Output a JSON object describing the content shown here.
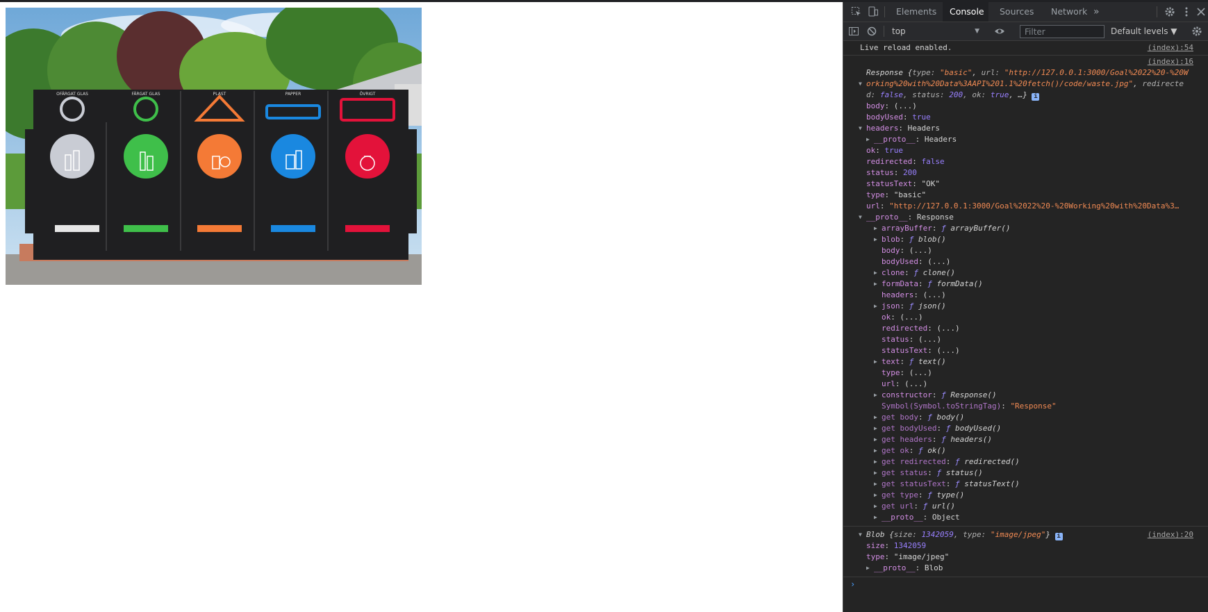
{
  "page": {
    "photo_alt": "Recycling station with bins labeled OFÄRGAT GLAS, FÄRGAT GLAS, PLAST, PAPPER, ÖVRIGT",
    "bin_labels": [
      "OFÄRGAT GLAS",
      "FÄRGAT GLAS",
      "PLAST",
      "PAPPER",
      "ÖVRIGT"
    ],
    "bin_colors": [
      "#c9ccd4",
      "#3fbf4a",
      "#f47a36",
      "#1a88e0",
      "#e3123a"
    ]
  },
  "devtools": {
    "tabs": [
      "Elements",
      "Console",
      "Sources",
      "Network"
    ],
    "active_tab": "Console",
    "more_tabs_glyph": "»",
    "context": "top",
    "filter_placeholder": "Filter",
    "levels": "Default levels ▼",
    "icons": [
      "inspect-icon",
      "device-toggle-icon",
      "settings-gear-icon",
      "kebab-menu-icon",
      "close-icon",
      "sidebar-toggle-icon",
      "clear-console-icon",
      "eye-icon"
    ]
  },
  "console": {
    "live_reload": "Live reload enabled.",
    "live_reload_src": "(index):54",
    "response_src": "(index):16",
    "blob_src": "(index):20",
    "response_summary": {
      "name": "Response",
      "type_val": "\"basic\"",
      "url_val_part1": "\"http://127.0.0.1:3000/Goal%2022%20-%20W",
      "url_val_part2": "orking%20with%20Data%3AAPI%201.1%20fetch()/code/waste.jpg\"",
      "redirected_part": "d",
      "redirected_val": "false",
      "status_val": "200",
      "ok_val": "true"
    },
    "response_props": [
      {
        "key": "body",
        "val": "(...)",
        "kind": "plain"
      },
      {
        "key": "bodyUsed",
        "val": "true",
        "kind": "bool"
      },
      {
        "key": "headers",
        "val": "Headers",
        "kind": "expanded"
      },
      {
        "key": "__proto__",
        "val": "Headers",
        "kind": "nested"
      },
      {
        "key": "ok",
        "val": "true",
        "kind": "bool"
      },
      {
        "key": "redirected",
        "val": "false",
        "kind": "bool"
      },
      {
        "key": "status",
        "val": "200",
        "kind": "num"
      },
      {
        "key": "statusText",
        "val": "\"OK\"",
        "kind": "str"
      },
      {
        "key": "type",
        "val": "\"basic\"",
        "kind": "str"
      },
      {
        "key": "url",
        "val": "\"http://127.0.0.1:3000/Goal%2022%20-%20Working%20with%20Data%3…",
        "kind": "str"
      },
      {
        "key": "__proto__",
        "val": "Response",
        "kind": "expanded"
      }
    ],
    "proto_members": [
      {
        "key": "arrayBuffer",
        "fn": "arrayBuffer()",
        "expandable": true
      },
      {
        "key": "blob",
        "fn": "blob()",
        "expandable": true
      },
      {
        "key": "body",
        "val": "(...)"
      },
      {
        "key": "bodyUsed",
        "val": "(...)"
      },
      {
        "key": "clone",
        "fn": "clone()",
        "expandable": true
      },
      {
        "key": "formData",
        "fn": "formData()",
        "expandable": true
      },
      {
        "key": "headers",
        "val": "(...)"
      },
      {
        "key": "json",
        "fn": "json()",
        "expandable": true
      },
      {
        "key": "ok",
        "val": "(...)"
      },
      {
        "key": "redirected",
        "val": "(...)"
      },
      {
        "key": "status",
        "val": "(...)"
      },
      {
        "key": "statusText",
        "val": "(...)"
      },
      {
        "key": "text",
        "fn": "text()",
        "expandable": true
      },
      {
        "key": "type",
        "val": "(...)"
      },
      {
        "key": "url",
        "val": "(...)"
      },
      {
        "key": "constructor",
        "fn": "Response()",
        "expandable": true
      },
      {
        "key": "Symbol(Symbol.toStringTag)",
        "val": "\"Response\"",
        "faded": true
      },
      {
        "key": "get body",
        "fn": "body()",
        "expandable": true,
        "faded": true
      },
      {
        "key": "get bodyUsed",
        "fn": "bodyUsed()",
        "expandable": true,
        "faded": true
      },
      {
        "key": "get headers",
        "fn": "headers()",
        "expandable": true,
        "faded": true
      },
      {
        "key": "get ok",
        "fn": "ok()",
        "expandable": true,
        "faded": true
      },
      {
        "key": "get redirected",
        "fn": "redirected()",
        "expandable": true,
        "faded": true
      },
      {
        "key": "get status",
        "fn": "status()",
        "expandable": true,
        "faded": true
      },
      {
        "key": "get statusText",
        "fn": "statusText()",
        "expandable": true,
        "faded": true
      },
      {
        "key": "get type",
        "fn": "type()",
        "expandable": true,
        "faded": true
      },
      {
        "key": "get url",
        "fn": "url()",
        "expandable": true,
        "faded": true
      },
      {
        "key": "__proto__",
        "val": "Object",
        "expandable": true,
        "plainval": true
      }
    ],
    "blob_summary": {
      "name": "Blob",
      "size_val": "1342059",
      "type_val": "\"image/jpeg\""
    },
    "blob_props": [
      {
        "key": "size",
        "val": "1342059",
        "kind": "num"
      },
      {
        "key": "type",
        "val": "\"image/jpeg\"",
        "kind": "str"
      },
      {
        "key": "__proto__",
        "val": "Blob",
        "kind": "nested"
      }
    ],
    "prompt_glyph": "›"
  }
}
